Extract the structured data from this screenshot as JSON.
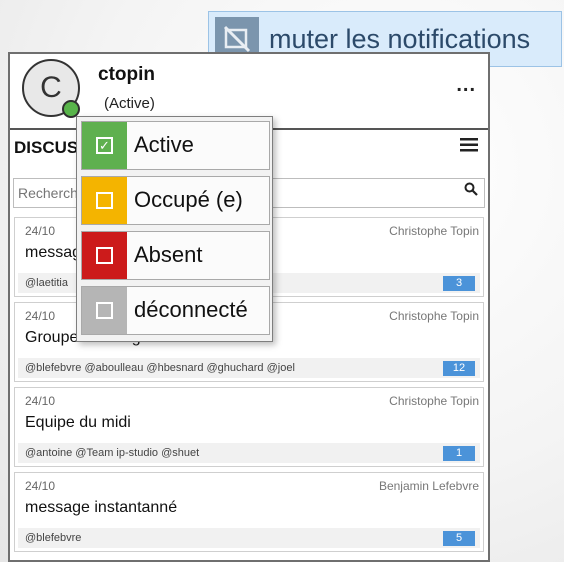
{
  "tooltip": {
    "text": "muter les notifications",
    "icon": "mute-notifications-icon"
  },
  "user": {
    "name": "ctopin",
    "status": "(Active)",
    "avatar_letter": "C",
    "status_color": "#58b44a"
  },
  "more_label": "...",
  "discussions": {
    "title": "DISCUSSIONS",
    "search_placeholder": "Rechercher",
    "items": [
      {
        "date": "24/10",
        "author": "Christophe Topin",
        "name": "message",
        "participants": "@laetitia",
        "count": "3"
      },
      {
        "date": "24/10",
        "author": "Christophe Topin",
        "name": "Groupe Morning",
        "participants": "@blefebvre @aboulleau @hbesnard @ghuchard @joel",
        "count": "12"
      },
      {
        "date": "24/10",
        "author": "Christophe Topin",
        "name": "Equipe du midi",
        "participants": "@antoine @Team ip-studio @shuet",
        "count": "1"
      },
      {
        "date": "24/10",
        "author": "Benjamin Lefebvre",
        "name": "message instantanné",
        "participants": "@blefebvre",
        "count": "5"
      }
    ]
  },
  "status_menu": [
    {
      "label": "Active",
      "color": "#5fb04f",
      "checked": true,
      "icon": "check-icon"
    },
    {
      "label": "Occupé (e)",
      "color": "#f4b400",
      "checked": false,
      "icon": "square-icon"
    },
    {
      "label": "Absent",
      "color": "#cc1b1b",
      "checked": false,
      "icon": "square-icon"
    },
    {
      "label": "déconnecté",
      "color": "#b5b5b5",
      "checked": false,
      "icon": "square-icon"
    }
  ]
}
